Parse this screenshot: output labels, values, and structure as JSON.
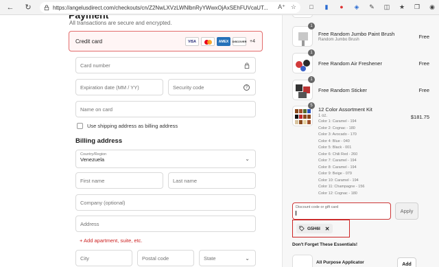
{
  "browser": {
    "url": "https://angelusdirect.com/checkouts/cn/Z2NwLXVzLWNlbnRyYWwxOjAxSEhFUVcaUT..."
  },
  "payment": {
    "title": "Payment",
    "subtitle": "All transactions are secure and encrypted.",
    "credit_card_label": "Credit card",
    "cards": [
      "VISA",
      "",
      "AMEX",
      "DISCOVER"
    ],
    "more_cards": "+4",
    "card_number_placeholder": "Card number",
    "expiration_placeholder": "Expiration date (MM / YY)",
    "security_code_placeholder": "Security code",
    "name_on_card_placeholder": "Name on card",
    "use_shipping_label": "Use shipping address as billing address"
  },
  "billing": {
    "title": "Billing address",
    "country_label": "Country/Region",
    "country_value": "Venezuela",
    "first_name_placeholder": "First name",
    "last_name_placeholder": "Last name",
    "company_placeholder": "Company (optional)",
    "address_placeholder": "Address",
    "add_apartment": "+ Add apartment, suite, etc.",
    "city_placeholder": "City",
    "postal_placeholder": "Postal code",
    "state_placeholder": "State"
  },
  "summary": {
    "items": [
      {
        "qty": "1",
        "name": "Free Random Jumbo Paint Brush",
        "sub": "Random Jumbo Brush",
        "price": "Free"
      },
      {
        "qty": "1",
        "name": "Free Random Air Freshener",
        "sub": "",
        "price": "Free"
      },
      {
        "qty": "1",
        "name": "Free Random Sticker",
        "sub": "",
        "price": "Free"
      },
      {
        "qty": "5",
        "name": "12 Color Assortment Kit",
        "sub": "1 oz.",
        "price": "$181.75"
      }
    ],
    "kit_colors": [
      "Color 1: Caramel - 194",
      "Color 2: Cognac - 180",
      "Color 3: Avocado - 170",
      "Color 4: Blue - 040",
      "Color 5: Black - 001",
      "Color 6: Chili Red - 260",
      "Color 7: Caramel - 194",
      "Color 8: Caramel - 194",
      "Color 9: Beige - 079",
      "Color 10: Caramel - 194",
      "Color 11: Champagne - 156",
      "Color 12: Cognac - 180"
    ],
    "discount_placeholder": "Discount code or gift card",
    "apply_label": "Apply",
    "applied_code": "G5H6I",
    "essentials_title": "Don't Forget These Essentials!",
    "essential_item": "All Purpose Applicator",
    "add_label": "Add"
  }
}
